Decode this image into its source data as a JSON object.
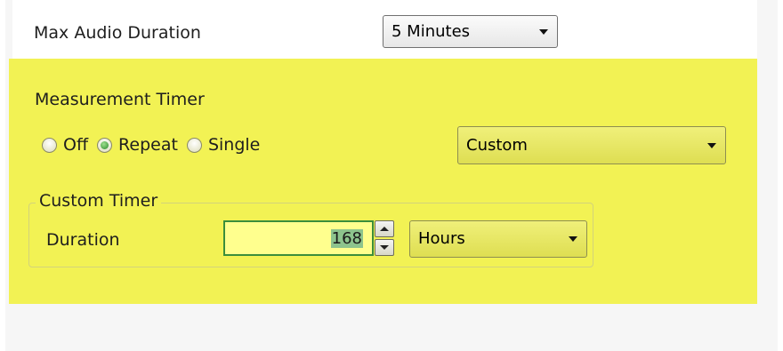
{
  "max_audio": {
    "label": "Max Audio Duration",
    "value": "5 Minutes"
  },
  "measurement_timer": {
    "heading": "Measurement Timer",
    "mode_options": [
      "Off",
      "Repeat",
      "Single"
    ],
    "selected_mode": "Repeat",
    "preset_value": "Custom"
  },
  "custom_timer": {
    "group_title": "Custom Timer",
    "duration_label": "Duration",
    "duration_value": "168",
    "unit_value": "Hours"
  },
  "colors": {
    "highlight": "#f2f254",
    "focus_border": "#3b8e3b",
    "input_background": "#ffff8e",
    "selection": "#8dc48d",
    "panel_background": "#f6f6f6"
  }
}
